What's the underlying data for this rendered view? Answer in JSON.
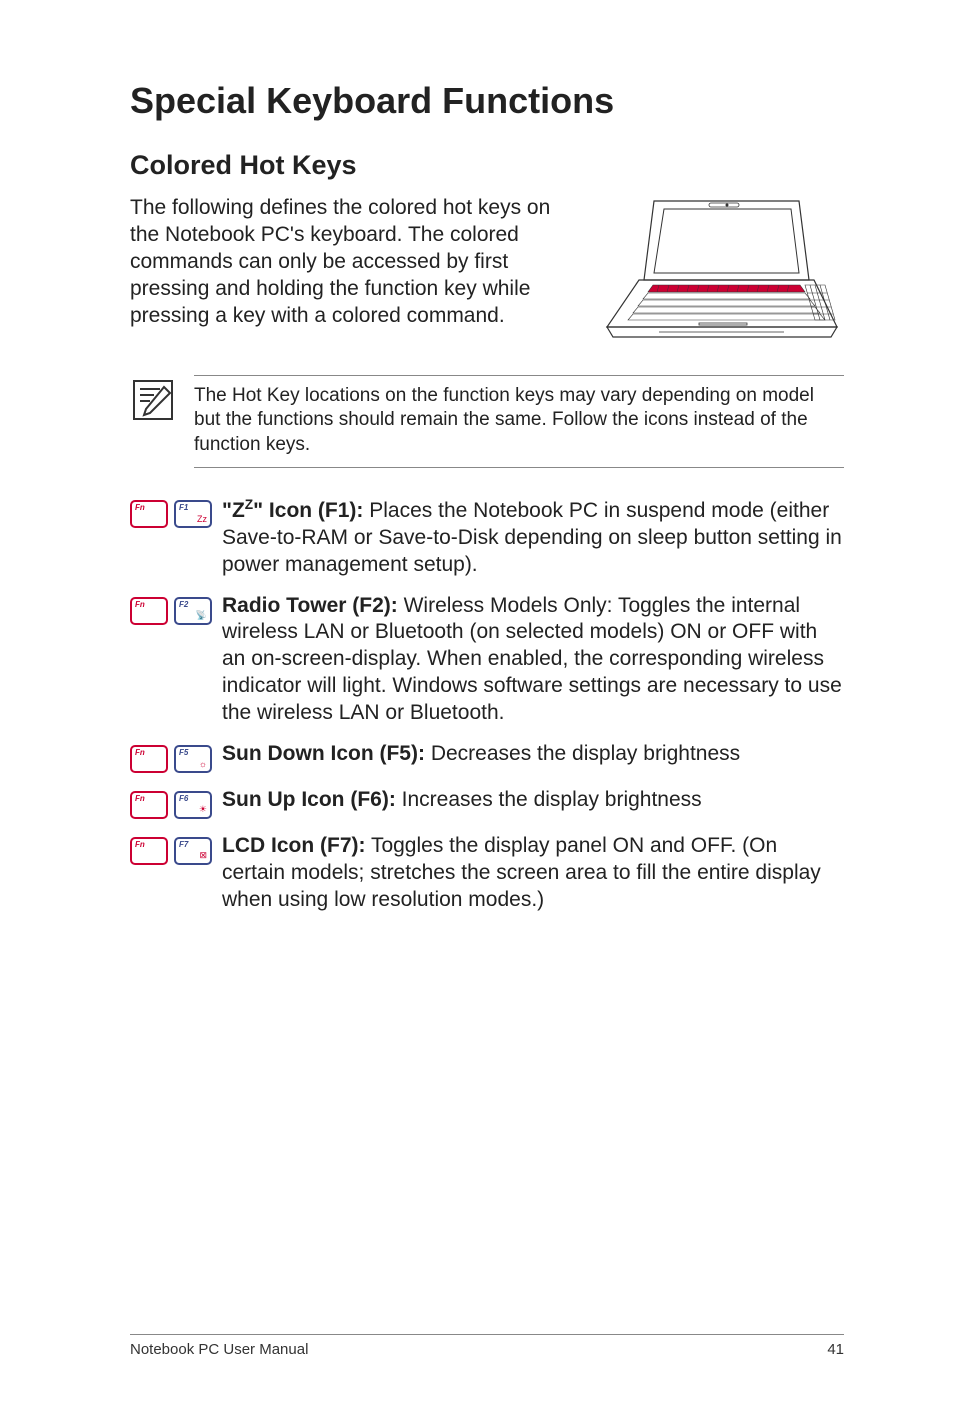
{
  "title": "Special Keyboard Functions",
  "section_heading": "Colored Hot Keys",
  "intro": "The following defines the colored hot keys on the Notebook PC's keyboard. The colored commands can only be accessed by first pressing and holding the function key while pressing a key with a colored command.",
  "note": "The Hot Key locations on the function keys may vary depending on model but the functions should remain the same. Follow the icons instead of the function keys.",
  "hotkeys": [
    {
      "fkey": "F1",
      "sym": "Zᴢ",
      "title_html": "\"Z<span class='sup'>Z</span>\" Icon (F1):",
      "desc": " Places the Notebook PC in suspend mode (either Save-to-RAM or Save-to-Disk depending on sleep button setting in power management setup)."
    },
    {
      "fkey": "F2",
      "sym": "📡",
      "title_html": "Radio Tower (F2):",
      "desc": " Wireless Models Only: Toggles the internal wireless LAN or Bluetooth (on selected models) ON or OFF with an on-screen-display. When enabled, the corresponding wireless indicator will light. Windows software settings are necessary to use the wireless LAN or Bluetooth."
    },
    {
      "fkey": "F5",
      "sym": "☼",
      "title_html": "Sun Down Icon (F5):",
      "desc": " Decreases the display brightness"
    },
    {
      "fkey": "F6",
      "sym": "☀",
      "title_html": "Sun Up Icon (F6):",
      "desc": " Increases the display brightness"
    },
    {
      "fkey": "F7",
      "sym": "⊠",
      "title_html": "LCD Icon (F7):",
      "desc": " Toggles the display panel ON and OFF. (On certain models; stretches the screen area to fill the entire display when using low resolution modes.)"
    }
  ],
  "footer_left": "Notebook PC User Manual",
  "footer_right": "41",
  "icons": {
    "note_icon_name": "note-sheet-pencil-icon",
    "laptop_icon_name": "laptop-illustration"
  }
}
